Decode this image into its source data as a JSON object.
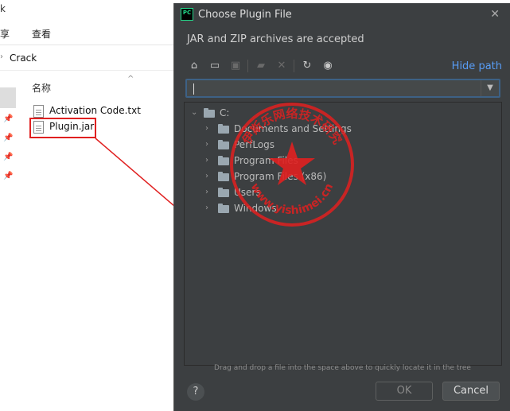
{
  "explorer": {
    "title_fragment": "k",
    "menu": {
      "share": "享",
      "view": "查看"
    },
    "path": {
      "current": "Crack"
    },
    "column_header": "名称",
    "files": [
      {
        "name": "Activation Code.txt"
      },
      {
        "name": "Plugin.jar"
      }
    ]
  },
  "dialog": {
    "app_logo": "PC",
    "title": "Choose Plugin File",
    "description": "JAR and ZIP archives are accepted",
    "hide_path_label": "Hide path",
    "path_value": "",
    "tree": [
      {
        "label": "C:",
        "level": 0,
        "expanded": true
      },
      {
        "label": "Documents and Settings",
        "level": 1,
        "expanded": false
      },
      {
        "label": "PerfLogs",
        "level": 1,
        "expanded": false
      },
      {
        "label": "Program Files",
        "level": 1,
        "expanded": false
      },
      {
        "label": "Program Files (x86)",
        "level": 1,
        "expanded": false
      },
      {
        "label": "Users",
        "level": 1,
        "expanded": false
      },
      {
        "label": "Windows",
        "level": 1,
        "expanded": false
      }
    ],
    "drop_hint": "Drag and drop a file into the space above to quickly locate it in the tree",
    "help_label": "?",
    "ok_label": "OK",
    "cancel_label": "Cancel"
  },
  "toolbar_icons": [
    "home-icon",
    "desktop-icon",
    "project-icon",
    "new-folder-icon",
    "delete-icon",
    "refresh-icon",
    "show-hidden-icon"
  ],
  "watermark": {
    "top_text": "伊斯乐网络技术研究",
    "bottom_text": "www.yishimei.cn"
  },
  "colors": {
    "dialog_bg": "#3c3f41",
    "accent_link": "#589df6",
    "annotation_red": "#e02020"
  }
}
